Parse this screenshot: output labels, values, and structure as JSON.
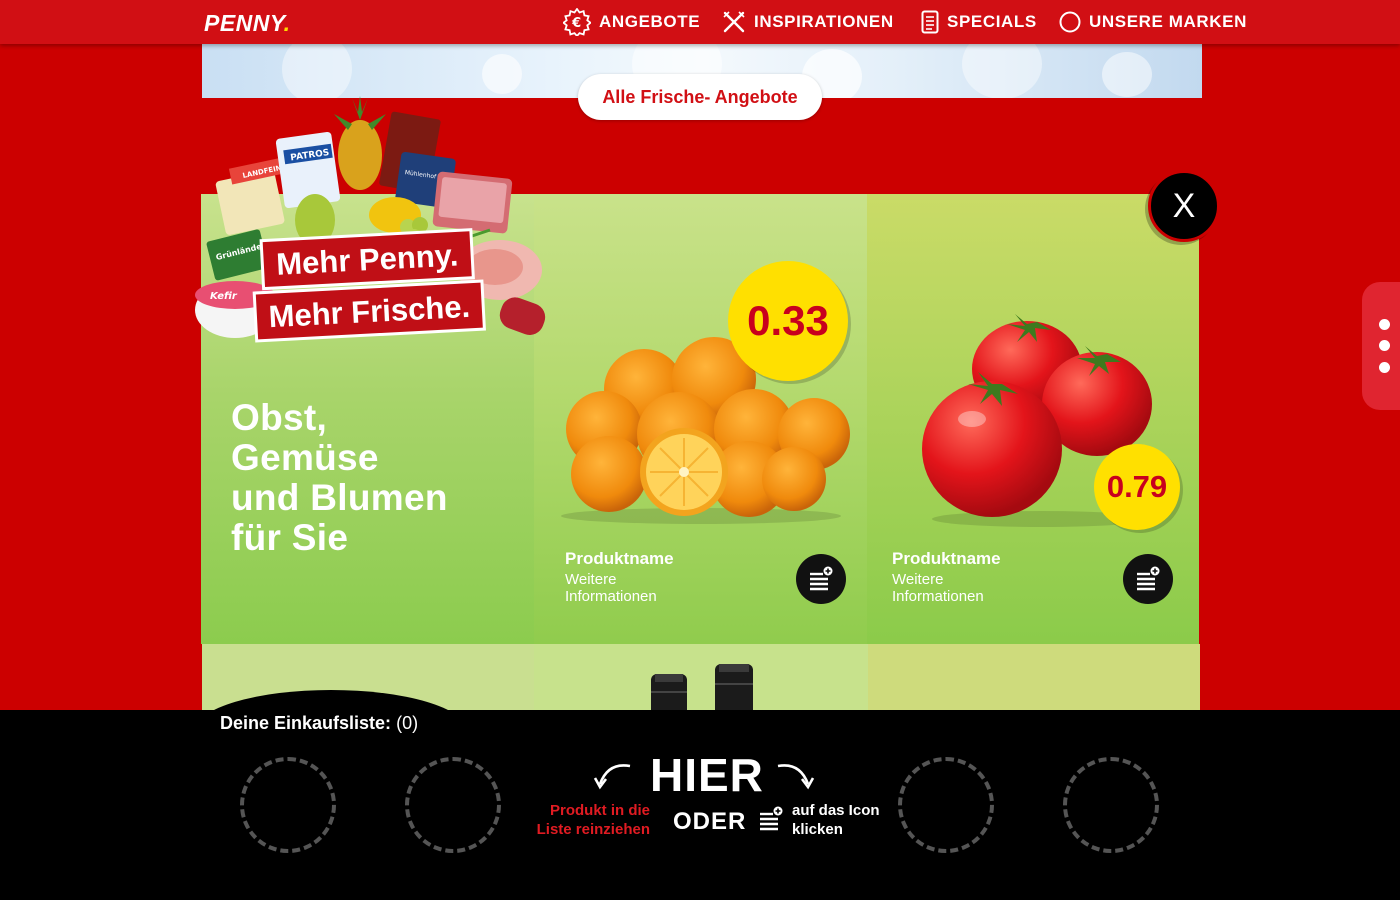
{
  "header": {
    "logo_text": "PENNY",
    "logo_dot": ".",
    "nav": [
      {
        "label": "ANGEBOTE",
        "icon": "euro-badge-icon"
      },
      {
        "label": "INSPIRATIONEN",
        "icon": "fork-knife-icon"
      },
      {
        "label": "SPECIALS",
        "icon": "document-icon"
      },
      {
        "label": "UNSERE MARKEN",
        "icon": "circle-icon"
      }
    ]
  },
  "hero": {
    "cta_label": "Alle Frische- Angebote"
  },
  "promo": {
    "line1": "Mehr Penny.",
    "line2": "Mehr Frische.",
    "brand_labels": [
      "PATROS",
      "Mühlenhof",
      "Grünländer",
      "LANDFEIN",
      "Kefir"
    ]
  },
  "category": {
    "headline_lines": [
      "Obst,",
      "Gemüse",
      "und Blumen",
      "für Sie"
    ]
  },
  "products": [
    {
      "name": "Produktname",
      "info": "Weitere Informationen",
      "price": "0.33",
      "image": "oranges"
    },
    {
      "name": "Produktname",
      "info": "Weitere Informationen",
      "price": "0.79",
      "image": "tomatoes"
    }
  ],
  "close_label": "X",
  "shopping_list": {
    "title": "Deine Einkaufsliste:",
    "count": "(0)",
    "drag_hint": "Produkt in die Liste reinziehen",
    "here": "HIER",
    "or": "ODER",
    "click_hint": "auf das Icon klicken"
  },
  "colors": {
    "brand_red": "#cc0000",
    "nav_red": "#d10f14",
    "price_yellow": "#ffe000",
    "price_text": "#c8001e",
    "logo_dot": "#ffdc00"
  }
}
